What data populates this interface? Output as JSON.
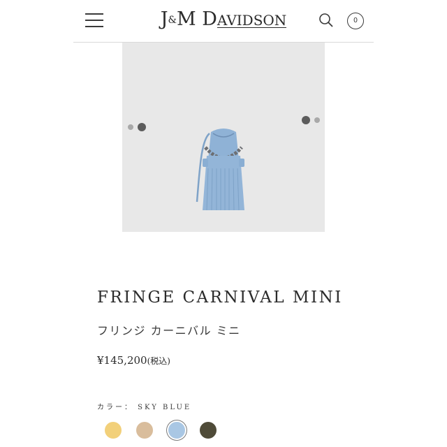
{
  "header": {
    "logo_j": "J",
    "logo_amp": "&",
    "logo_m": "M D",
    "logo_rest": "AVIDSON",
    "cart_count": "0"
  },
  "product": {
    "title": "FRINGE CARNIVAL MINI",
    "subtitle": "フリンジ カーニバル ミニ",
    "price": "¥145,200",
    "tax_note": "(税込)",
    "color_label": "カラー： SKY BLUE",
    "image_color": "#8fb2d6"
  },
  "swatches": [
    {
      "color": "#f2d07a",
      "selected": false
    },
    {
      "color": "#d9bd9c",
      "selected": false
    },
    {
      "color": "#a9c7e4",
      "selected": true
    },
    {
      "color": "#4f4b38",
      "selected": false
    }
  ],
  "icons": [
    "menu-icon",
    "search-icon",
    "cart-icon"
  ]
}
